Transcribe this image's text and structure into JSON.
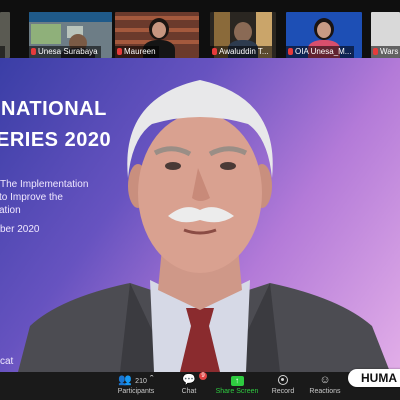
{
  "participants": [
    {
      "name": ""
    },
    {
      "name": "Unesa Surabaya"
    },
    {
      "name": "Maureen"
    },
    {
      "name": "Awaluddin T..."
    },
    {
      "name": "OIA Unesa_M..."
    },
    {
      "name": "Wars"
    }
  ],
  "slide": {
    "line1": "NATIONAL",
    "line2": "ERIES 2020",
    "line3": "The Implementation",
    "line4": "to Improve the",
    "line5": "ation",
    "line6": "ber 2020",
    "footer": "cat"
  },
  "toolbar": {
    "participants_count": "210",
    "participants_label": "Participants",
    "chat_label": "Chat",
    "chat_badge": "9",
    "share_label": "Share Screen",
    "record_label": "Record",
    "reactions_label": "Reactions"
  },
  "watermark": {
    "text": "HUMA"
  },
  "colors": {
    "share_accent": "#2ecc40",
    "mic_muted": "#e63b3b"
  },
  "icons": [
    "participants-icon",
    "chat-icon",
    "share-screen-icon",
    "record-icon",
    "reactions-icon",
    "mic-muted-icon"
  ]
}
